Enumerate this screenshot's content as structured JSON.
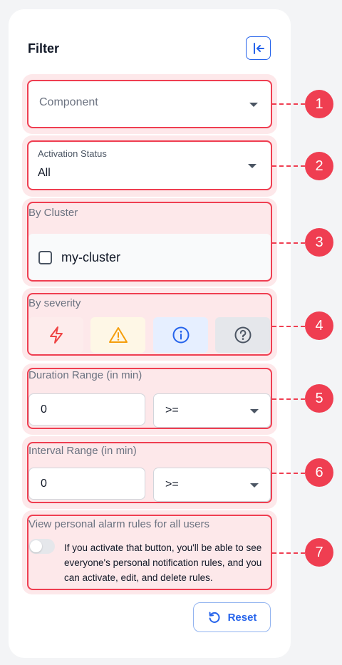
{
  "filter": {
    "title": "Filter"
  },
  "component": {
    "placeholder": "Component"
  },
  "activation_status": {
    "label": "Activation Status",
    "value": "All"
  },
  "cluster": {
    "label": "By Cluster",
    "options": [
      {
        "name": "my-cluster",
        "checked": false
      }
    ]
  },
  "severity": {
    "label": "By severity",
    "levels": [
      {
        "name": "critical",
        "icon": "lightning-icon",
        "color": "#ef4444",
        "bg": "#fdecec"
      },
      {
        "name": "warning",
        "icon": "warning-triangle-icon",
        "color": "#f59e0b",
        "bg": "#fef7e6"
      },
      {
        "name": "info",
        "icon": "info-circle-icon",
        "color": "#2563eb",
        "bg": "#e6efff"
      },
      {
        "name": "unknown",
        "icon": "question-circle-icon",
        "color": "#4b5563",
        "bg": "#e5e7eb"
      }
    ]
  },
  "duration": {
    "label": "Duration Range (in min)",
    "value": "0",
    "operator": ">="
  },
  "interval": {
    "label": "Interval Range (in min)",
    "value": "0",
    "operator": ">="
  },
  "personal_rules": {
    "label": "View personal alarm rules for all users",
    "enabled": false,
    "description": "If you activate that button, you'll be able to see everyone's personal notification rules, and you can activate, edit, and delete rules."
  },
  "actions": {
    "reset_label": "Reset"
  },
  "annotations": [
    "1",
    "2",
    "3",
    "4",
    "5",
    "6",
    "7"
  ],
  "colors": {
    "accent": "#2563eb",
    "annotation": "#ef3e51",
    "annotation_bg": "#fde8ea"
  }
}
